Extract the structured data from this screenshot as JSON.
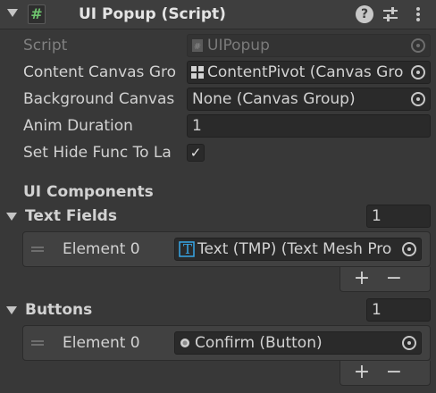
{
  "header": {
    "script_icon": "#",
    "title": "UI Popup (Script)",
    "help_icon": "?"
  },
  "fields": {
    "script": {
      "label": "Script",
      "value": "UIPopup"
    },
    "content_canvas": {
      "label": "Content Canvas Gro",
      "value": "ContentPivot (Canvas Gro"
    },
    "background_canvas": {
      "label": "Background Canvas",
      "value": "None (Canvas Group)"
    },
    "anim_duration": {
      "label": "Anim Duration",
      "value": "1"
    },
    "set_hide_func": {
      "label": "Set Hide Func To La",
      "checked": true,
      "check_glyph": "✓"
    }
  },
  "sections": {
    "ui_components": {
      "label": "UI Components"
    },
    "text_fields": {
      "label": "Text Fields",
      "size": "1",
      "element_label": "Element 0",
      "element_value": "Text (TMP) (Text Mesh Pro",
      "element_icon": "T",
      "add_label": "+",
      "remove_label": "−"
    },
    "buttons": {
      "label": "Buttons",
      "size": "1",
      "element_label": "Element 0",
      "element_value": "Confirm (Button)",
      "add_label": "+",
      "remove_label": "−"
    }
  }
}
